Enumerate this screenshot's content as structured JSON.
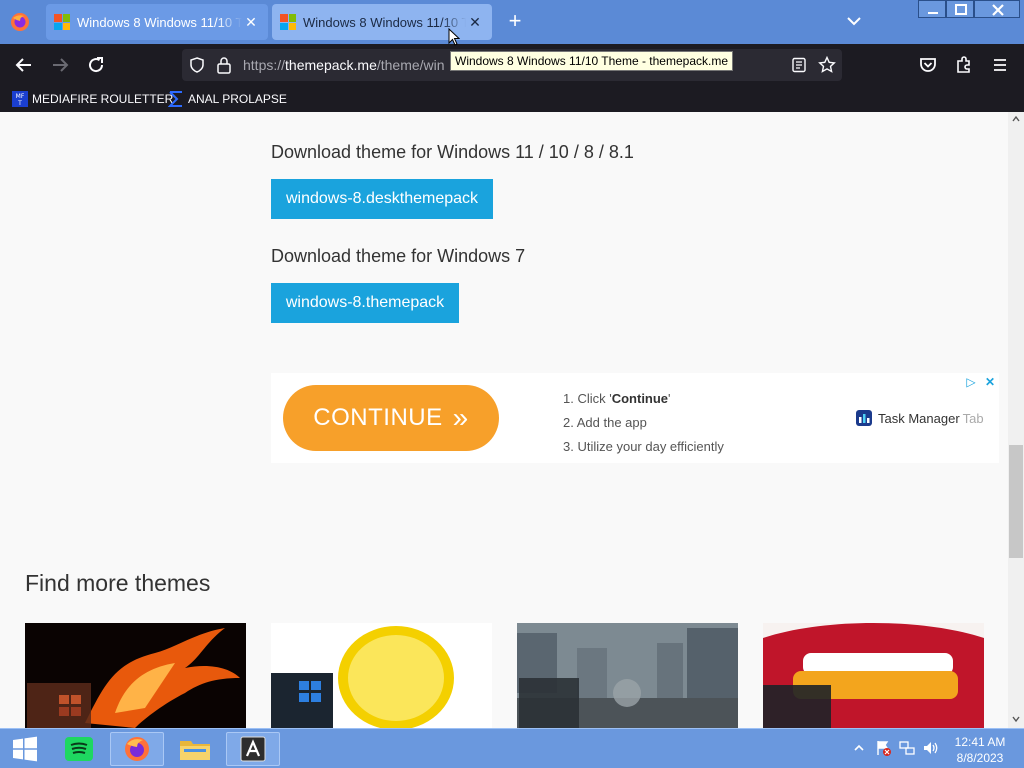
{
  "browser": {
    "tabs": [
      {
        "title": "Windows 8 Windows 11/10 Theme - themepack.me",
        "active": false
      },
      {
        "title": "Windows 8 Windows 11/10 Theme - themepack.me",
        "active": true
      }
    ],
    "url_prefix": "https://",
    "url_host": "themepack.me",
    "url_path": "/theme/win",
    "tooltip": "Windows 8 Windows 11/10 Theme - themepack.me"
  },
  "bookmarks": [
    {
      "label": "MEDIAFIRE ROULETTER",
      "icon": "mediafire-icon"
    },
    {
      "label": "ANAL PROLAPSE",
      "icon": "sigma-icon"
    }
  ],
  "page": {
    "download_win11_heading": "Download theme for Windows 11 / 10 / 8 / 8.1",
    "download_win11_button": "windows-8.deskthemepack",
    "download_win7_heading": "Download theme for Windows 7",
    "download_win7_button": "windows-8.themepack",
    "ad": {
      "cta": "CONTINUE",
      "cta_arrows": "»",
      "step1_prefix": "1. Click '",
      "step1_bold": "Continue",
      "step1_suffix": "'",
      "step2": "2. Add the app",
      "step3": "3. Utilize your day efficiently",
      "brand": "Task Manager",
      "brand_suffix": "Tab"
    },
    "more_heading": "Find more themes",
    "thumbnails": [
      "phoenix-theme",
      "lemon-theme",
      "ruined-city-theme",
      "candy-lips-theme"
    ]
  },
  "taskbar": {
    "items": [
      "windows-start",
      "spotify",
      "firefox",
      "file-explorer",
      "app-a"
    ],
    "time": "12:41 AM",
    "date": "8/8/2023"
  },
  "colors": {
    "download_button": "#1aa3dd",
    "ad_cta": "#f7a02a",
    "tabstrip": "#5b8ad6",
    "toolbar": "#1c1b22"
  }
}
